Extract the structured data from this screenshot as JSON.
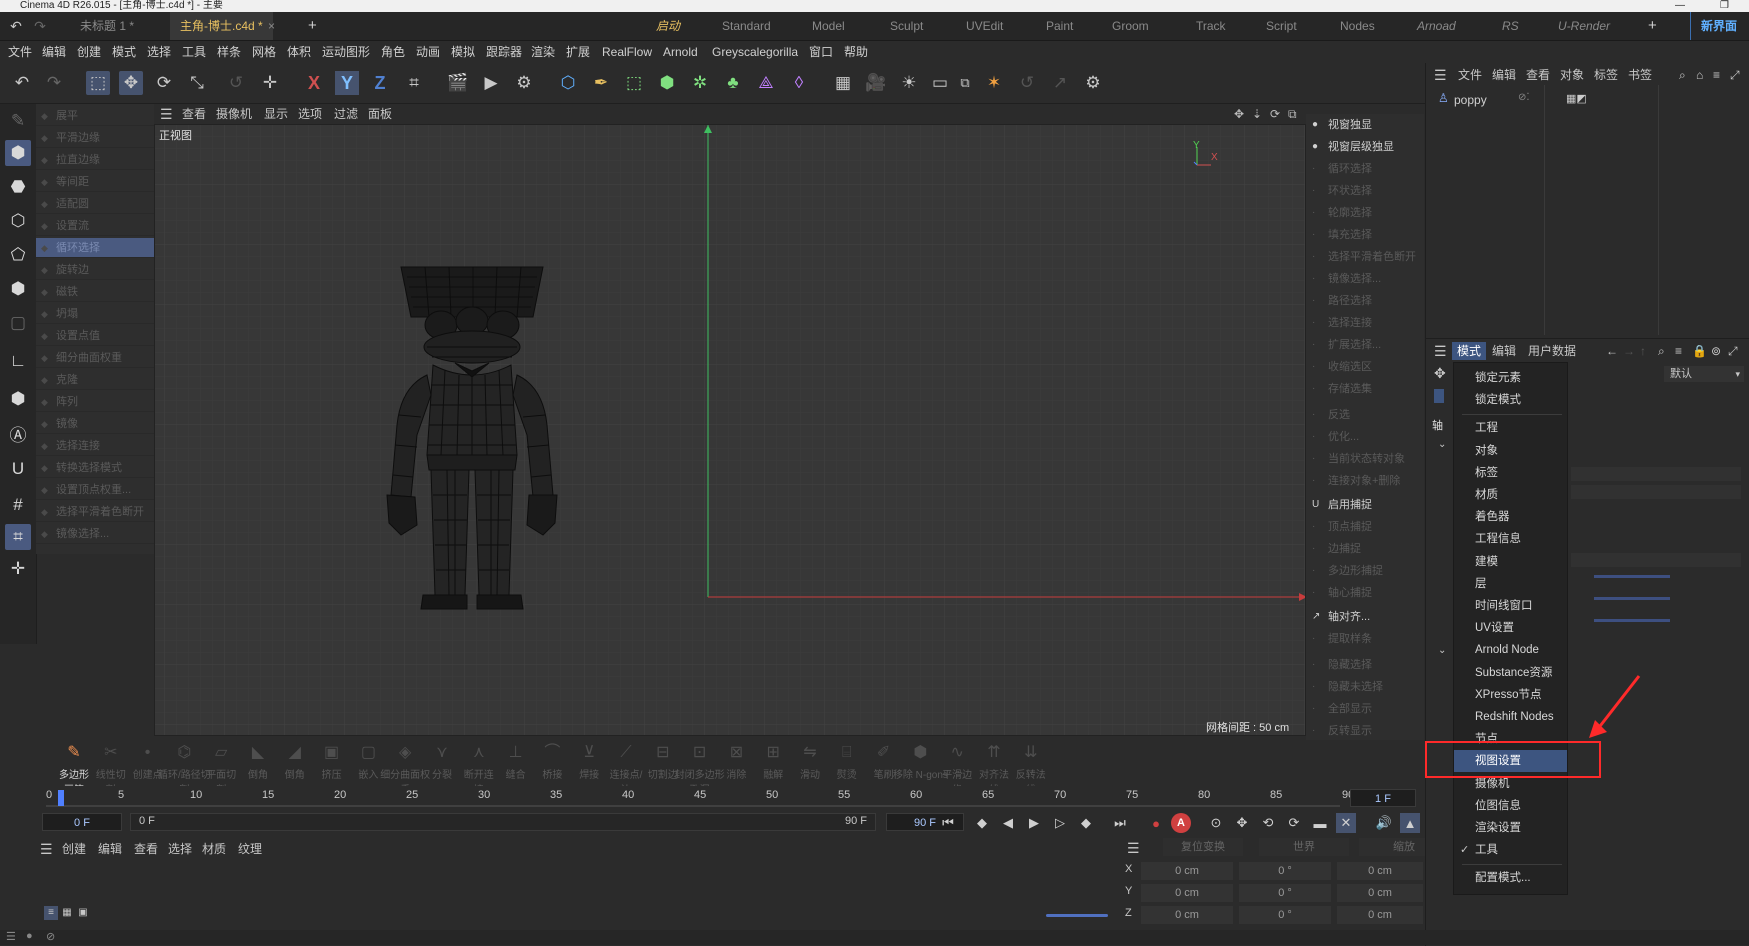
{
  "window": {
    "title": "Cinema 4D R26.015 - [主角-博士.c4d *] - 主要",
    "controls": [
      "—",
      "❐"
    ]
  },
  "doc_tabs": [
    {
      "label": "未标题 1 *",
      "active": false
    },
    {
      "label": "主角-博士.c4d *",
      "active": true
    }
  ],
  "doc_tab_close": "×",
  "doc_tab_add": "+",
  "layout_tabs": [
    {
      "label": "启动",
      "state": "active"
    },
    {
      "label": "Standard",
      "state": ""
    },
    {
      "label": "Model",
      "state": ""
    },
    {
      "label": "Sculpt",
      "state": ""
    },
    {
      "label": "UVEdit",
      "state": ""
    },
    {
      "label": "Paint",
      "state": ""
    },
    {
      "label": "Groom",
      "state": ""
    },
    {
      "label": "Track",
      "state": ""
    },
    {
      "label": "Script",
      "state": ""
    },
    {
      "label": "Nodes",
      "state": ""
    },
    {
      "label": "Arnoad",
      "state": "italic"
    },
    {
      "label": "RS",
      "state": "italic"
    },
    {
      "label": "U-Render",
      "state": "italic"
    }
  ],
  "layout_add": "+",
  "new_interface": "新界面",
  "menus": [
    "文件",
    "编辑",
    "创建",
    "模式",
    "选择",
    "工具",
    "样条",
    "网格",
    "体积",
    "运动图形",
    "角色",
    "动画",
    "模拟",
    "跟踪器",
    "渲染",
    "扩展",
    "RealFlow",
    "Arnold",
    "Greyscalegorilla",
    "窗口",
    "帮助"
  ],
  "axis_labels": {
    "x": "X",
    "y": "Y",
    "z": "Z"
  },
  "left_commands": [
    {
      "label": "展平",
      "icon": "◆",
      "hl": false
    },
    {
      "label": "平滑边缘",
      "icon": "◆",
      "hl": false
    },
    {
      "label": "拉直边缘",
      "icon": "◆",
      "hl": false
    },
    {
      "label": "等间距",
      "icon": "◆",
      "hl": false
    },
    {
      "label": "适配圆",
      "icon": "◆",
      "hl": false
    },
    {
      "label": "设置流",
      "icon": "◆",
      "hl": false
    },
    {
      "label": "循环选择",
      "icon": "◆",
      "hl": true
    },
    {
      "label": "旋转边",
      "icon": "◆",
      "hl": false
    },
    {
      "label": "磁铁",
      "icon": "◆",
      "hl": false
    },
    {
      "label": "坍塌",
      "icon": "◆",
      "hl": false
    },
    {
      "label": "设置点值",
      "icon": "◆",
      "hl": false
    },
    {
      "label": "细分曲面权重",
      "icon": "◆",
      "hl": false
    },
    {
      "label": "克隆",
      "icon": "◆",
      "hl": false
    },
    {
      "label": "阵列",
      "icon": "◆",
      "hl": false
    },
    {
      "label": "镜像",
      "icon": "◆",
      "hl": false
    },
    {
      "label": "选择连接",
      "icon": "◆",
      "hl": false
    },
    {
      "label": "转换选择模式",
      "icon": "◆",
      "hl": false
    },
    {
      "label": "设置顶点权重...",
      "icon": "◆",
      "hl": false
    },
    {
      "label": "选择平滑着色断开",
      "icon": "◆",
      "hl": false
    },
    {
      "label": "镜像选择...",
      "icon": "◆",
      "hl": false
    }
  ],
  "viewport": {
    "menus": [
      "查看",
      "摄像机",
      "显示",
      "选项",
      "过滤",
      "面板"
    ],
    "label": "正视图",
    "grid_info": "网格间距 : 50 cm",
    "axis_y": "Y",
    "axis_x": "X",
    "nav_icons": [
      "✥",
      "⇣",
      "⟳",
      "⧉"
    ]
  },
  "right_commands": [
    {
      "label": "视窗独显",
      "icon": "●",
      "bright": true
    },
    {
      "label": "视窗层级独显",
      "icon": "●",
      "bright": true
    },
    {
      "label": "循环选择",
      "icon": "·",
      "bright": false
    },
    {
      "label": "环状选择",
      "icon": "·",
      "bright": false
    },
    {
      "label": "轮廓选择",
      "icon": "·",
      "bright": false
    },
    {
      "label": "填充选择",
      "icon": "·",
      "bright": false
    },
    {
      "label": "选择平滑着色断开",
      "icon": "·",
      "bright": false
    },
    {
      "label": "镜像选择...",
      "icon": "·",
      "bright": false
    },
    {
      "label": "路径选择",
      "icon": "·",
      "bright": false
    },
    {
      "label": "选择连接",
      "icon": "·",
      "bright": false
    },
    {
      "label": "扩展选择...",
      "icon": "·",
      "bright": false
    },
    {
      "label": "收缩选区",
      "icon": "·",
      "bright": false
    },
    {
      "label": "存储选集",
      "icon": "·",
      "bright": false
    },
    {
      "label": "反选",
      "icon": "·",
      "bright": false
    },
    {
      "label": "优化...",
      "icon": "·",
      "bright": false
    },
    {
      "label": "当前状态转对象",
      "icon": "·",
      "bright": false
    },
    {
      "label": "连接对象+删除",
      "icon": "·",
      "bright": false
    },
    {
      "label": "启用捕捉",
      "icon": "U",
      "bright": true
    },
    {
      "label": "顶点捕捉",
      "icon": "·",
      "bright": false
    },
    {
      "label": "边捕捉",
      "icon": "·",
      "bright": false
    },
    {
      "label": "多边形捕捉",
      "icon": "·",
      "bright": false
    },
    {
      "label": "轴心捕捉",
      "icon": "·",
      "bright": false
    },
    {
      "label": "轴对齐...",
      "icon": "↗",
      "bright": true
    },
    {
      "label": "提取样条",
      "icon": "·",
      "bright": false
    },
    {
      "label": "隐藏选择",
      "icon": "·",
      "bright": false
    },
    {
      "label": "隐藏未选择",
      "icon": "·",
      "bright": false
    },
    {
      "label": "全部显示",
      "icon": "·",
      "bright": false
    },
    {
      "label": "反转显示",
      "icon": "·",
      "bright": false
    }
  ],
  "modeling_tools": [
    {
      "label": "多边形画笔",
      "icon": "✎",
      "on": true
    },
    {
      "label": "线性切割",
      "icon": "✂",
      "on": false
    },
    {
      "label": "创建点",
      "icon": "•",
      "on": false
    },
    {
      "label": "循环/路径切割",
      "icon": "⌬",
      "on": false
    },
    {
      "label": "平面切割",
      "icon": "▱",
      "on": false
    },
    {
      "label": "倒角",
      "icon": "◣",
      "on": false
    },
    {
      "label": "倒角",
      "icon": "◢",
      "on": false
    },
    {
      "label": "挤压",
      "icon": "▣",
      "on": false
    },
    {
      "label": "嵌入",
      "icon": "▢",
      "on": false
    },
    {
      "label": "细分曲面权重",
      "icon": "◈",
      "on": false
    },
    {
      "label": "分裂",
      "icon": "⋎",
      "on": false
    },
    {
      "label": "断开连接",
      "icon": "⋏",
      "on": false
    },
    {
      "label": "缝合",
      "icon": "⊥",
      "on": false
    },
    {
      "label": "桥接",
      "icon": "⌒",
      "on": false
    },
    {
      "label": "焊接",
      "icon": "⊻",
      "on": false
    },
    {
      "label": "连接点/边",
      "icon": "⟋",
      "on": false
    },
    {
      "label": "切割边",
      "icon": "⊟",
      "on": false
    },
    {
      "label": "封闭多边形孔洞",
      "icon": "⊡",
      "on": false
    },
    {
      "label": "消除",
      "icon": "⊠",
      "on": false
    },
    {
      "label": "融解",
      "icon": "⊞",
      "on": false
    },
    {
      "label": "滑动",
      "icon": "⇋",
      "on": false
    },
    {
      "label": "熨烫",
      "icon": "⌸",
      "on": false
    },
    {
      "label": "笔刷",
      "icon": "✐",
      "on": false
    },
    {
      "label": "移除 N-gons",
      "icon": "⬢",
      "on": false
    },
    {
      "label": "平滑边缘",
      "icon": "∿",
      "on": false
    },
    {
      "label": "对齐法线",
      "icon": "⇈",
      "on": false
    },
    {
      "label": "反转法线",
      "icon": "⇊",
      "on": false
    }
  ],
  "timeline": {
    "ticks": [
      "0",
      "5",
      "10",
      "15",
      "20",
      "25",
      "30",
      "35",
      "40",
      "45",
      "50",
      "55",
      "60",
      "65",
      "70",
      "75",
      "80",
      "85",
      "90"
    ],
    "current_frame": "1 F",
    "start_field": "0 F",
    "range_start": "0 F",
    "range_end": "90 F",
    "end_field": "90 F",
    "record_label": "A"
  },
  "material_menus": [
    "创建",
    "编辑",
    "查看",
    "选择",
    "材质",
    "纹理"
  ],
  "coordinates": {
    "headers": [
      "复位变换",
      "世界",
      "缩放"
    ],
    "rows": [
      {
        "axis": "X",
        "pos": "0 cm",
        "rot": "0 °",
        "size": "0 cm"
      },
      {
        "axis": "Y",
        "pos": "0 cm",
        "rot": "0 °",
        "size": "0 cm"
      },
      {
        "axis": "Z",
        "pos": "0 cm",
        "rot": "0 °",
        "size": "0 cm"
      }
    ]
  },
  "object_manager": {
    "menus": [
      "文件",
      "编辑",
      "查看",
      "对象",
      "标签",
      "书签"
    ],
    "object_name": "poppy"
  },
  "attribute_manager": {
    "tabs": [
      "模式",
      "编辑",
      "用户数据"
    ],
    "preset": "默认",
    "side_label": "轴"
  },
  "mode_dropdown": {
    "groups": [
      [
        "锁定元素",
        "锁定模式"
      ],
      [
        "工程",
        "对象",
        "标签",
        "材质",
        "着色器",
        "工程信息",
        "建模",
        "层",
        "时间线窗口",
        "UV设置",
        "Arnold Node",
        "Substance资源",
        "XPresso节点",
        "Redshift Nodes",
        "节点",
        "视图设置",
        "摄像机",
        "位图信息",
        "渲染设置",
        "工具"
      ],
      [
        "配置模式..."
      ]
    ],
    "selected": "视图设置",
    "checked": "工具"
  },
  "colors": {
    "accent_tab": "#e8c060",
    "selection": "#3d5580",
    "highlight_box": "#ff2a2a",
    "arrow": "#ff2a2a"
  }
}
